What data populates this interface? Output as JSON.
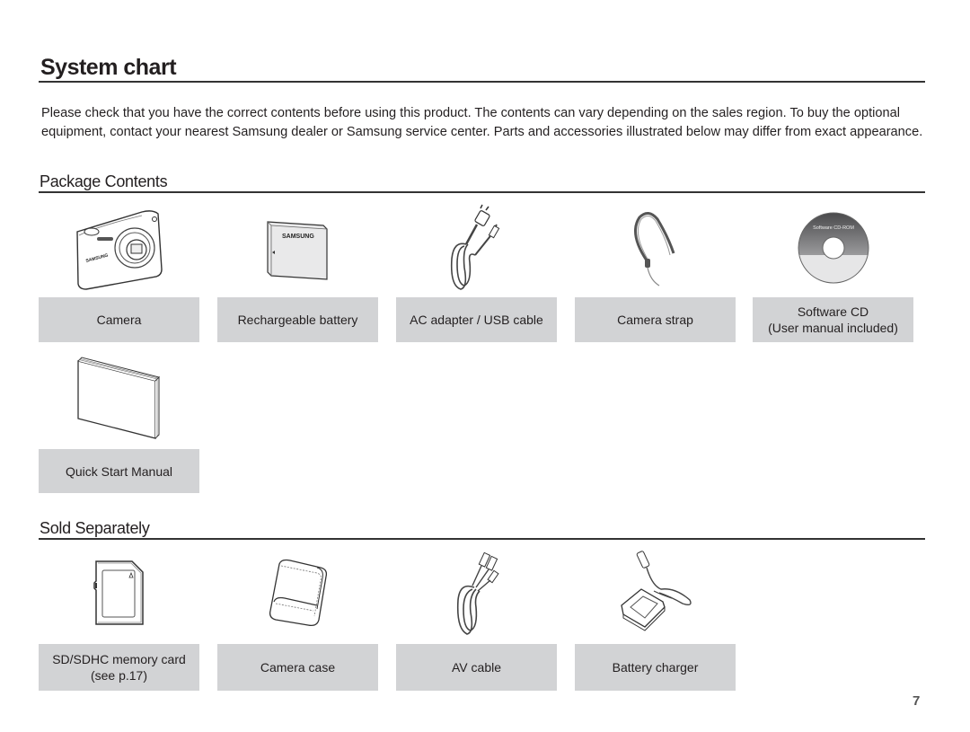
{
  "page": {
    "title": "System chart",
    "intro": "Please check that you have the correct contents before using this product. The contents can vary depending on the sales region. To buy the optional equipment, contact your nearest Samsung dealer or Samsung service center. Parts and accessories illustrated below may differ from exact appearance.",
    "page_number": "7"
  },
  "package_contents": {
    "heading": "Package Contents",
    "items": [
      {
        "label": "Camera",
        "icon": "camera-icon",
        "brand_text": "SAMSUNG"
      },
      {
        "label": "Rechargeable battery",
        "icon": "battery-icon",
        "brand_text": "SAMSUNG"
      },
      {
        "label": "AC adapter / USB cable",
        "icon": "ac-adapter-usb-cable-icon"
      },
      {
        "label": "Camera strap",
        "icon": "camera-strap-icon"
      },
      {
        "label": "Software CD",
        "label_line2": "(User manual included)",
        "icon": "software-cd-icon",
        "disc_text": "Software CD-ROM"
      },
      {
        "label": "Quick Start Manual",
        "icon": "quick-start-manual-icon"
      }
    ]
  },
  "sold_separately": {
    "heading": "Sold Separately",
    "items": [
      {
        "label": "SD/SDHC memory card",
        "label_line2": "(see p.17)",
        "icon": "memory-card-icon"
      },
      {
        "label": "Camera case",
        "icon": "camera-case-icon"
      },
      {
        "label": "AV cable",
        "icon": "av-cable-icon"
      },
      {
        "label": "Battery charger",
        "icon": "battery-charger-icon"
      }
    ]
  }
}
